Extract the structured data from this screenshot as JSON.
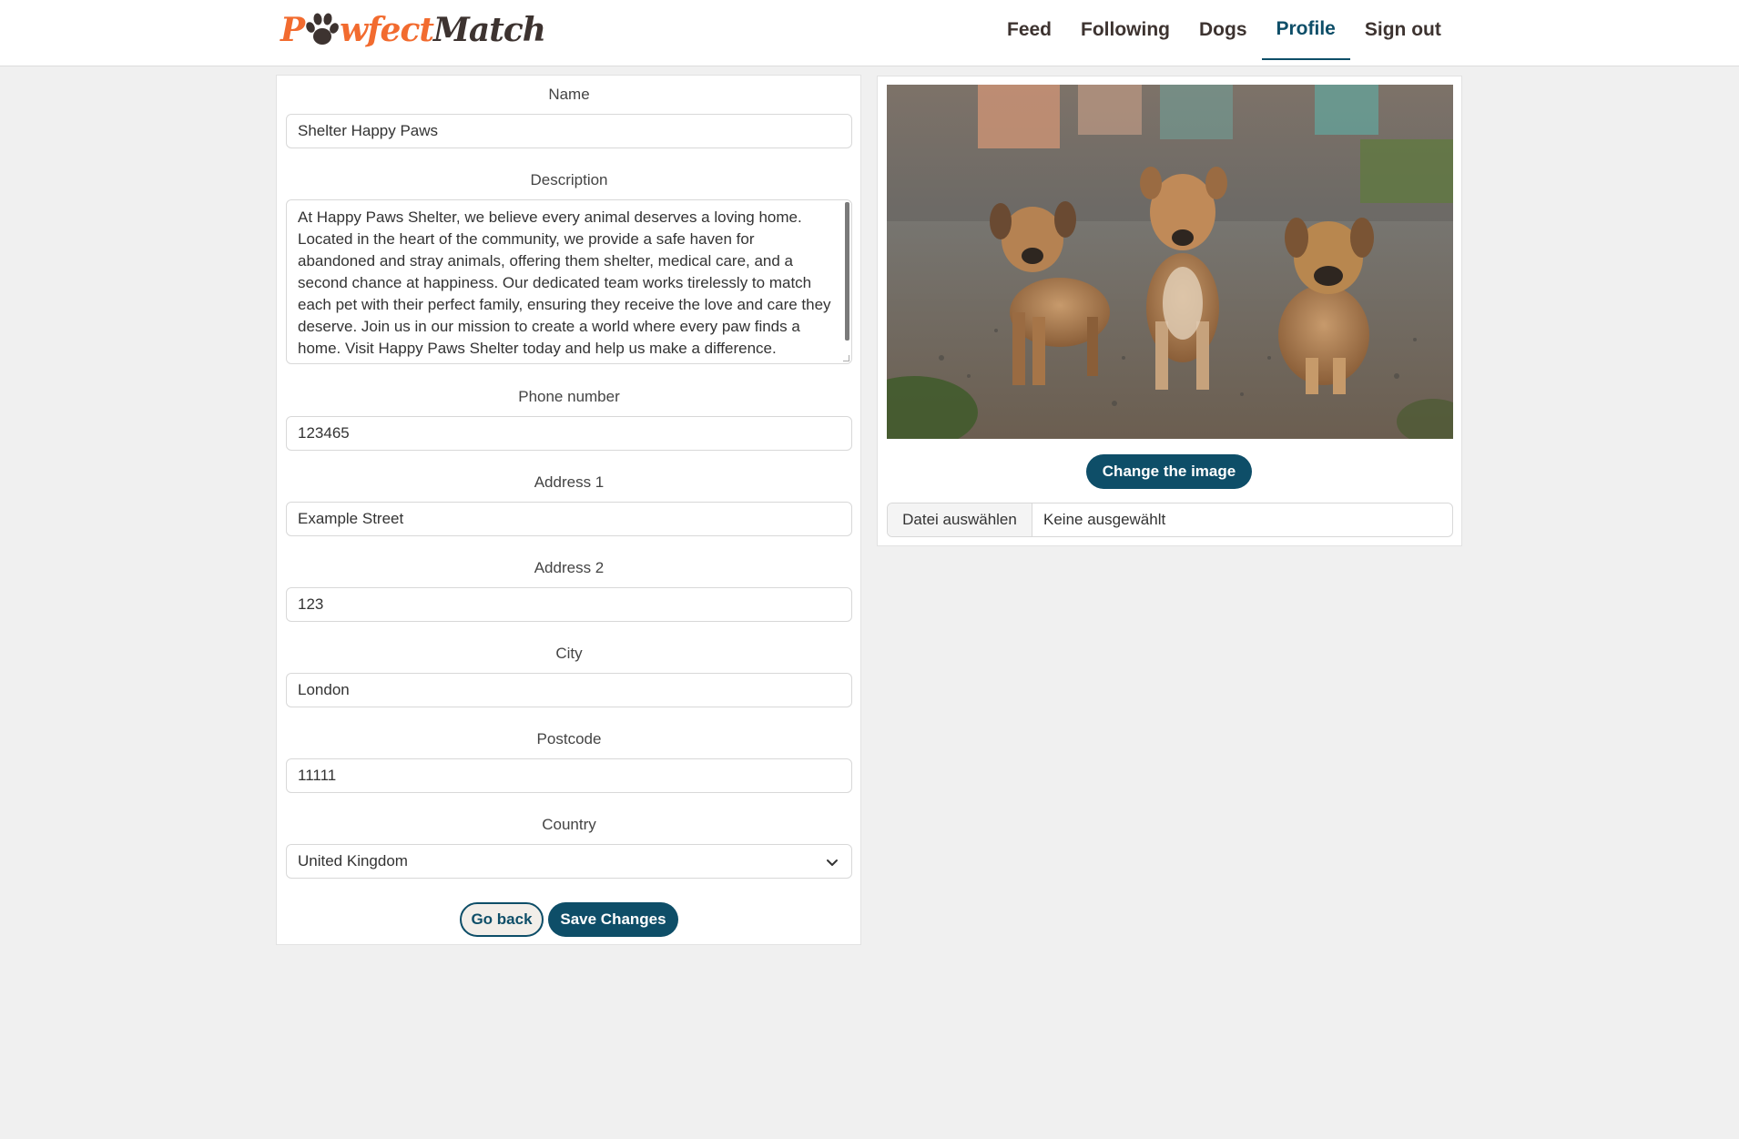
{
  "brand": {
    "logo_prefix": "P",
    "logo_middle": "wfect",
    "logo_suffix": "Match",
    "accent_color": "#f26b2f",
    "dark_color": "#3d3330"
  },
  "nav": {
    "items": [
      {
        "label": "Feed",
        "active": false
      },
      {
        "label": "Following",
        "active": false
      },
      {
        "label": "Dogs",
        "active": false
      },
      {
        "label": "Profile",
        "active": true
      },
      {
        "label": "Sign out",
        "active": false
      }
    ],
    "active_color": "#0e4e68"
  },
  "form": {
    "name": {
      "label": "Name",
      "value": "Shelter Happy Paws"
    },
    "description": {
      "label": "Description",
      "value": "At Happy Paws Shelter, we believe every animal deserves a loving home. Located in the heart of the community, we provide a safe haven for abandoned and stray animals, offering them shelter, medical care, and a second chance at happiness. Our dedicated team works tirelessly to match each pet with their perfect family, ensuring they receive the love and care they deserve. Join us in our mission to create a world where every paw finds a home. Visit Happy Paws Shelter today and help us make a difference."
    },
    "phone": {
      "label": "Phone number",
      "value": "123465"
    },
    "address1": {
      "label": "Address 1",
      "value": "Example Street"
    },
    "address2": {
      "label": "Address 2",
      "value": "123"
    },
    "city": {
      "label": "City",
      "value": "London"
    },
    "postcode": {
      "label": "Postcode",
      "value": "11111"
    },
    "country": {
      "label": "Country",
      "value": "United Kingdom"
    },
    "go_back_label": "Go back",
    "save_label": "Save Changes"
  },
  "image_panel": {
    "photo_icon": "dog-photo",
    "change_image_label": "Change the image",
    "file_button_label": "Datei auswählen",
    "file_status": "Keine ausgewählt"
  },
  "colors": {
    "primary": "#0e4e68",
    "page_bg": "#f0f0f0"
  }
}
